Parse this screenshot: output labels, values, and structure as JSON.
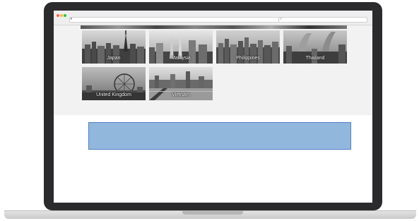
{
  "browser": {
    "address_icon": "lock-icon",
    "search_icon": "search-icon",
    "traffic_lights": [
      "#ff5f57",
      "#febc2e",
      "#28c840"
    ]
  },
  "gallery": {
    "countries": [
      {
        "label": "Japan",
        "scene": "skyline-tower"
      },
      {
        "label": "Malaysia",
        "scene": "twin-towers"
      },
      {
        "label": "Philippines",
        "scene": "city-blocks"
      },
      {
        "label": "Thailand",
        "scene": "curved-towers"
      },
      {
        "label": "United Kingdom",
        "scene": "ferris-wheel"
      },
      {
        "label": "Vietnam",
        "scene": "harbor-skyline"
      }
    ]
  },
  "banner": {
    "color": "#92b7dd",
    "border": "#4f7fc4"
  }
}
